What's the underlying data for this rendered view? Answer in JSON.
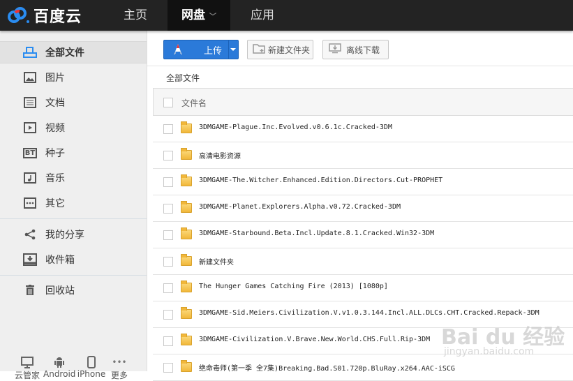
{
  "header": {
    "logo_text": "百度云",
    "nav": [
      {
        "label": "主页"
      },
      {
        "label": "网盘",
        "active": true
      },
      {
        "label": "应用"
      }
    ]
  },
  "sidebar": {
    "items": [
      {
        "label": "全部文件",
        "icon": "all-files-icon",
        "selected": true
      },
      {
        "label": "图片",
        "icon": "image-icon"
      },
      {
        "label": "文档",
        "icon": "document-icon"
      },
      {
        "label": "视频",
        "icon": "video-icon"
      },
      {
        "label": "种子",
        "icon": "bt-icon"
      },
      {
        "label": "音乐",
        "icon": "music-icon"
      },
      {
        "label": "其它",
        "icon": "more-icon"
      },
      {
        "label": "我的分享",
        "icon": "share-icon"
      },
      {
        "label": "收件箱",
        "icon": "inbox-icon"
      },
      {
        "label": "回收站",
        "icon": "trash-icon"
      }
    ],
    "bt_text": "BT",
    "clients": [
      {
        "label": "云管家",
        "icon": "desktop-icon"
      },
      {
        "label": "Android",
        "icon": "android-icon"
      },
      {
        "label": "iPhone",
        "icon": "phone-icon"
      },
      {
        "label": "更多",
        "icon": "ellipsis-icon"
      }
    ]
  },
  "toolbar": {
    "upload": "上传",
    "new_folder": "新建文件夹",
    "offline": "离线下载"
  },
  "breadcrumb": "全部文件",
  "table": {
    "header": "文件名",
    "files": [
      "3DMGAME-Plague.Inc.Evolved.v0.6.1c.Cracked-3DM",
      "高清电影资源",
      "3DMGAME-The.Witcher.Enhanced.Edition.Directors.Cut-PROPHET",
      "3DMGAME-Planet.Explorers.Alpha.v0.72.Cracked-3DM",
      "3DMGAME-Starbound.Beta.Incl.Update.8.1.Cracked.Win32-3DM",
      "新建文件夹",
      "The Hunger Games Catching Fire (2013) [1080p]",
      "3DMGAME-Sid.Meiers.Civilization.V.v1.0.3.144.Incl.ALL.DLCs.CHT.Cracked.Repack-3DM",
      "3DMGAME-Civilization.V.Brave.New.World.CHS.Full.Rip-3DM",
      "绝命毒师(第一季 全7集)Breaking.Bad.S01.720p.BluRay.x264.AAC-iSCG"
    ]
  },
  "watermark": {
    "main": "Bai du 经验",
    "url": "jingyan.baidu.com"
  },
  "colors": {
    "header": "#232323",
    "accent": "#2b7ad9",
    "folder": "#f1b73a"
  }
}
